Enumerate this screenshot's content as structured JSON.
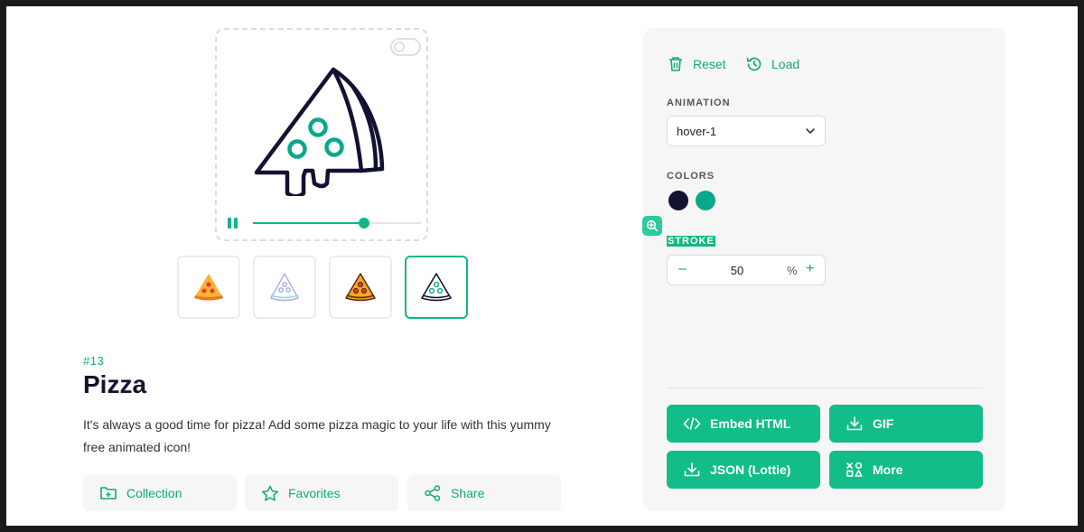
{
  "preview": {
    "progress": 0.66
  },
  "thumbnails": [
    {
      "style": "flat"
    },
    {
      "style": "lineal-gradient"
    },
    {
      "style": "outline-flat"
    },
    {
      "style": "wired-outline",
      "selected": true
    }
  ],
  "icon": {
    "number": "#13",
    "title": "Pizza",
    "description": "It's always a good time for pizza! Add some pizza magic to your life with this yummy free animated icon!"
  },
  "actions": {
    "collection": "Collection",
    "favorites": "Favorites",
    "share": "Share"
  },
  "panel": {
    "reset": "Reset",
    "load": "Load",
    "animation_label": "ANIMATION",
    "animation_value": "hover-1",
    "colors_label": "COLORS",
    "colors": [
      "#121331",
      "#08a88a"
    ],
    "stroke_label": "STROKE",
    "stroke_minus": "–",
    "stroke_value": "50",
    "stroke_unit": "%",
    "stroke_plus": "+"
  },
  "downloads": {
    "embed": "Embed HTML",
    "gif": "GIF",
    "json": "JSON (Lottie)",
    "more": "More"
  },
  "theme": {
    "accent": "#12b886",
    "dark": "#121331",
    "secondary": "#08a88a"
  }
}
